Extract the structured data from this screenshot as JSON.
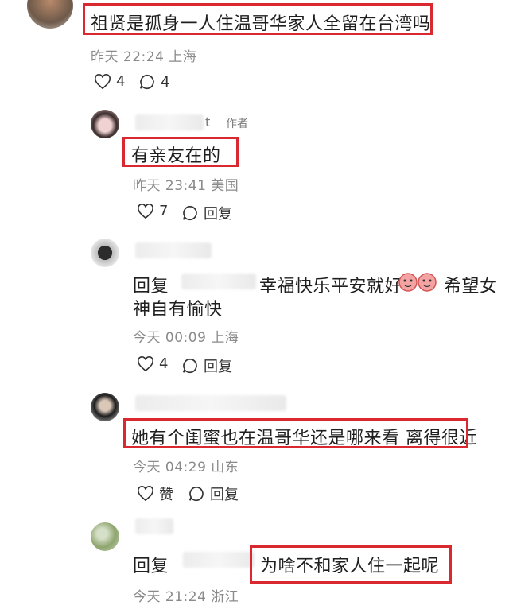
{
  "comments": [
    {
      "text": "祖贤是孤身一人住温哥华家人全留在台湾吗",
      "meta": "昨天 22:24 上海",
      "likes": "4",
      "replies": "4"
    },
    {
      "author_suffix": "t",
      "author_tag": "作者",
      "text": "有亲友在的",
      "meta": "昨天 23:41 美国",
      "likes": "7",
      "reply_label": "回复"
    },
    {
      "prefix": "回复",
      "text_line1": "幸福快乐平安就好",
      "text_line2_a": "希望女",
      "text_line2_b": "神自有愉快",
      "meta": "今天 00:09 上海",
      "likes": "4",
      "reply_label": "回复"
    },
    {
      "text": "她有个闺蜜也在温哥华还是哪来看 离得很近",
      "meta": "今天 04:29 山东",
      "like_label": "赞",
      "reply_label": "回复"
    },
    {
      "prefix": "回复",
      "text": "为啥不和家人住一起呢",
      "meta": "今天 21:24 浙江"
    }
  ],
  "colors": {
    "highlight": "#d9282f",
    "meta": "#8a8a8a"
  },
  "icons": [
    "heart-icon",
    "comment-icon",
    "emoji-icon"
  ]
}
